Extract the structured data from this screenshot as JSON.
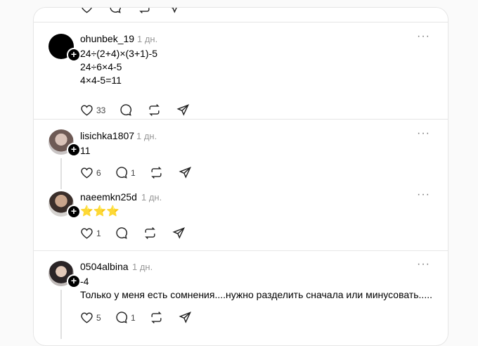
{
  "posts": [
    {
      "username": "ohunbek_19",
      "time": "1 дн.",
      "text": "24÷(2+4)×(3+1)-5\n24÷6×4-5\n4×4-5=11",
      "likes": "33",
      "replies": ""
    },
    {
      "username": "lisichka1807",
      "time": "1 дн.",
      "text": "11",
      "likes": "6",
      "replies": "1"
    },
    {
      "username": "naeemkn25d",
      "time": "1 дн.",
      "text": "⭐⭐⭐",
      "likes": "1",
      "replies": ""
    },
    {
      "username": "0504albina",
      "time": "1 дн.",
      "text": "-4\nТолько у меня есть сомнения....нужно разделить сначала или минусовать.....",
      "likes": "5",
      "replies": "1"
    }
  ],
  "icons": {
    "more": "more-dots-icon",
    "like": "heart-icon",
    "reply": "comment-icon",
    "repost": "repost-icon",
    "share": "send-icon",
    "follow": "plus-icon"
  }
}
